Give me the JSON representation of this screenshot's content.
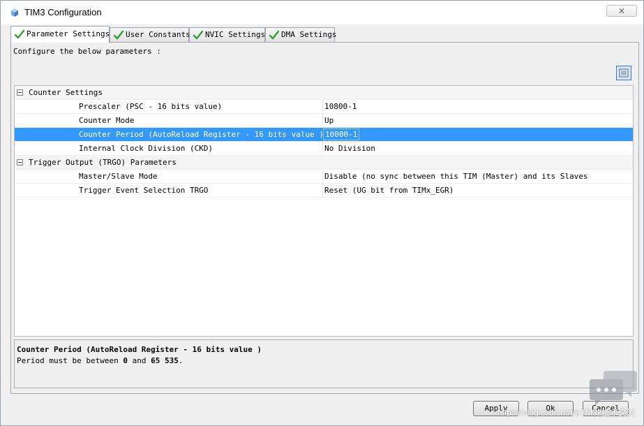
{
  "window": {
    "title": "TIM3 Configuration",
    "close_label": "⨯"
  },
  "tabs": [
    {
      "label": "Parameter Settings",
      "active": true
    },
    {
      "label": "User Constants",
      "active": false
    },
    {
      "label": "NVIC Settings",
      "active": false
    },
    {
      "label": "DMA Settings",
      "active": false
    }
  ],
  "instruction": "Configure the below parameters :",
  "groups": {
    "counter": {
      "label": "Counter Settings",
      "params": [
        {
          "name": "Prescaler (PSC - 16 bits value)",
          "value": "10800-1"
        },
        {
          "name": "Counter Mode",
          "value": "Up"
        },
        {
          "name": "Counter Period (AutoReload Register - 16 bits value )",
          "value": "10000-1"
        },
        {
          "name": "Internal Clock Division (CKD)",
          "value": "No Division"
        }
      ]
    },
    "trigger": {
      "label": "Trigger Output (TRGO) Parameters",
      "params": [
        {
          "name": "Master/Slave Mode",
          "value": "Disable (no sync between this TIM (Master) and its Slaves"
        },
        {
          "name": "Trigger Event Selection TRGO",
          "value": "Reset (UG bit from TIMx_EGR)"
        }
      ]
    }
  },
  "description": {
    "title": "Counter Period (AutoReload Register - 16 bits value )",
    "prefix": "Period must be between ",
    "min": "0",
    "mid": " and ",
    "max": "65 535",
    "suffix": "."
  },
  "buttons": {
    "apply": "Apply",
    "ok": "Ok",
    "cancel": "Cancel"
  },
  "watermark": "https://blog.csdn.net/STM32技术交流",
  "colors": {
    "selection": "#3399ff",
    "check_green": "#2e9e2e",
    "accent_blue": "#3f74c3"
  },
  "icons": {
    "app": "cube-icon",
    "tab_status": "checkmark-icon",
    "view_toggle": "list-view-icon",
    "group_toggle": "collapse-minus-icon"
  }
}
